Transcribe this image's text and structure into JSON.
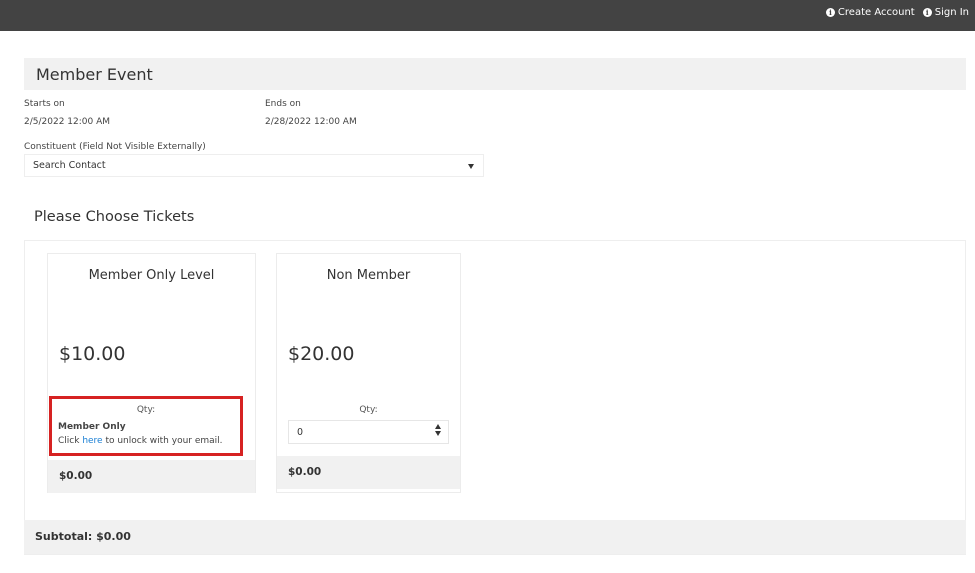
{
  "header": {
    "create_account": "Create Account",
    "sign_in": "Sign In"
  },
  "event": {
    "title": "Member Event",
    "starts_label": "Starts on",
    "starts_value": "2/5/2022 12:00 AM",
    "ends_label": "Ends on",
    "ends_value": "2/28/2022 12:00 AM"
  },
  "constituent": {
    "label": "Constituent (Field Not Visible Externally)",
    "selected": "Search Contact"
  },
  "tickets": {
    "section_title": "Please Choose Tickets",
    "items": [
      {
        "name": "Member Only Level",
        "price": "$10.00",
        "qty_label": "Qty:",
        "member_only": "Member Only",
        "unlock_prefix": "Click ",
        "unlock_link": "here",
        "unlock_suffix": " to unlock with your email.",
        "total": "$0.00"
      },
      {
        "name": "Non Member",
        "price": "$20.00",
        "qty_label": "Qty:",
        "qty_value": "0",
        "total": "$0.00"
      }
    ]
  },
  "subtotal": "Subtotal: $0.00",
  "colors": {
    "topbar": "#434343",
    "highlight_border": "#d62222",
    "link": "#1a7fd4"
  }
}
